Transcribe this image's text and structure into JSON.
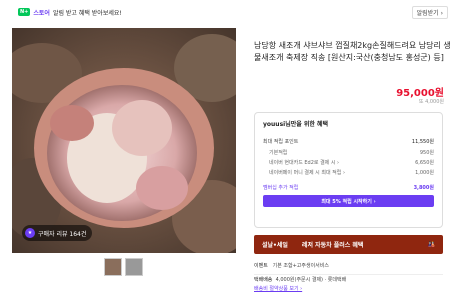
{
  "notice": {
    "badge": "N+",
    "store": "스토어",
    "text": "알림 받고 혜택 받아보세요!",
    "button": "알림받기 ›"
  },
  "gallery": {
    "review_text": "구매자 리뷰 164건"
  },
  "product": {
    "title": "남당항 새조개 샤브샤브 껍질채2kg손질해드려요 남당리 생물새조개 축제장 직송 [원산지:국산(충청남도 홍성군) 등]",
    "price": "95,000원",
    "sub_price": "또 4,000원"
  },
  "benefit": {
    "title": "youusi님만을 위한 혜택",
    "max_label": "최대 적립 포인트",
    "max_value": "11,550원",
    "basic_label": "기본적립",
    "basic_value": "950원",
    "card_label": "네이버 현대카드 Ed2로 결제 시 ›",
    "card_value": "6,650원",
    "pay_label": "네이버페이 머니 결제 시 최대 적립 ›",
    "pay_value": "1,000원",
    "member_label": "멤버십 추가 적립",
    "member_value": "3,800원",
    "cta": "최대 5% 적립 시작하기 ›"
  },
  "banner": {
    "left1": "설날•세일",
    "left2": "레저 자동차 플러스 혜택",
    "icon": "🎎"
  },
  "info": {
    "event_label": "이벤트",
    "event_text": "기본 조합+고주생이서비스",
    "delivery_label": "택배배송",
    "delivery_text": "4,000원(주문시 결제) · 롯데택배",
    "delivery_link": "배송비 절약상품 보기 ›"
  },
  "colors": {
    "accent": "#6b3df2",
    "price": "#e8102f",
    "naver_green": "#03c75a",
    "banner": "#8f260f"
  }
}
